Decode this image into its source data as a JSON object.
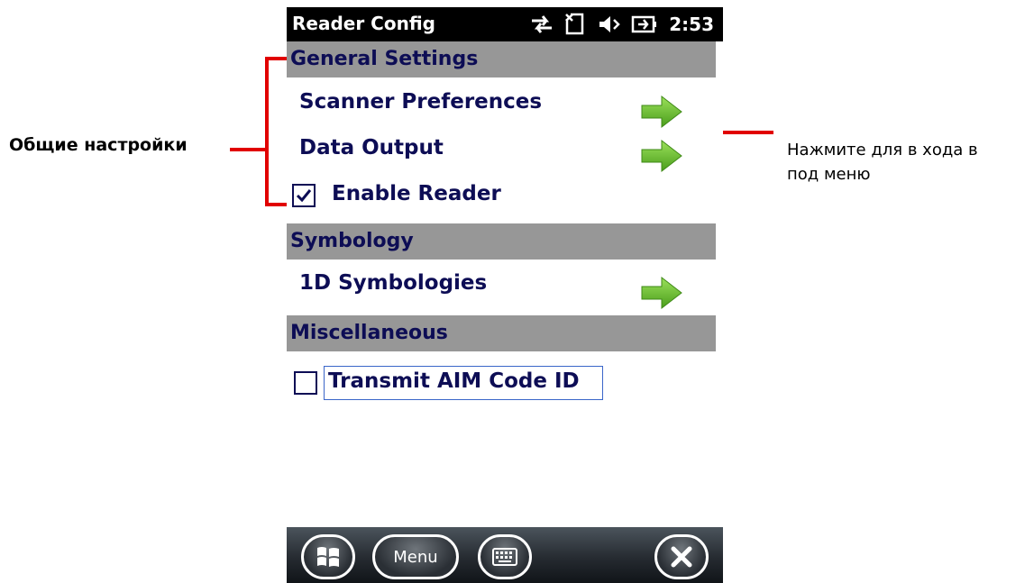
{
  "status_bar": {
    "app_title": "Reader Config",
    "time": "2:53",
    "icons": [
      "sync-arrows-icon",
      "sim-card-icon",
      "speaker-muted-icon",
      "battery-charging-icon"
    ]
  },
  "sections": {
    "general": {
      "header": "General Settings",
      "items": {
        "scanner_preferences": "Scanner Preferences",
        "data_output": "Data Output",
        "enable_reader": "Enable Reader"
      },
      "enable_reader_checked": true
    },
    "symbology": {
      "header": "Symbology",
      "items": {
        "one_d": "1D Symbologies"
      }
    },
    "misc": {
      "header": "Miscellaneous",
      "items": {
        "transmit_aim": "Transmit AIM Code ID"
      },
      "transmit_aim_checked": false
    }
  },
  "taskbar": {
    "menu_label": "Menu",
    "icons": [
      "windows-start-icon",
      "keyboard-icon",
      "close-icon"
    ]
  },
  "annotations": {
    "left_label": "Общие настройки",
    "right_line1": "Нажмите для в хода в",
    "right_line2": "под меню"
  },
  "colors": {
    "header_bg": "#979797",
    "text_navy": "#0d0d55",
    "annotation_red": "#e10000",
    "arrow_green": "#6cbb2a"
  }
}
